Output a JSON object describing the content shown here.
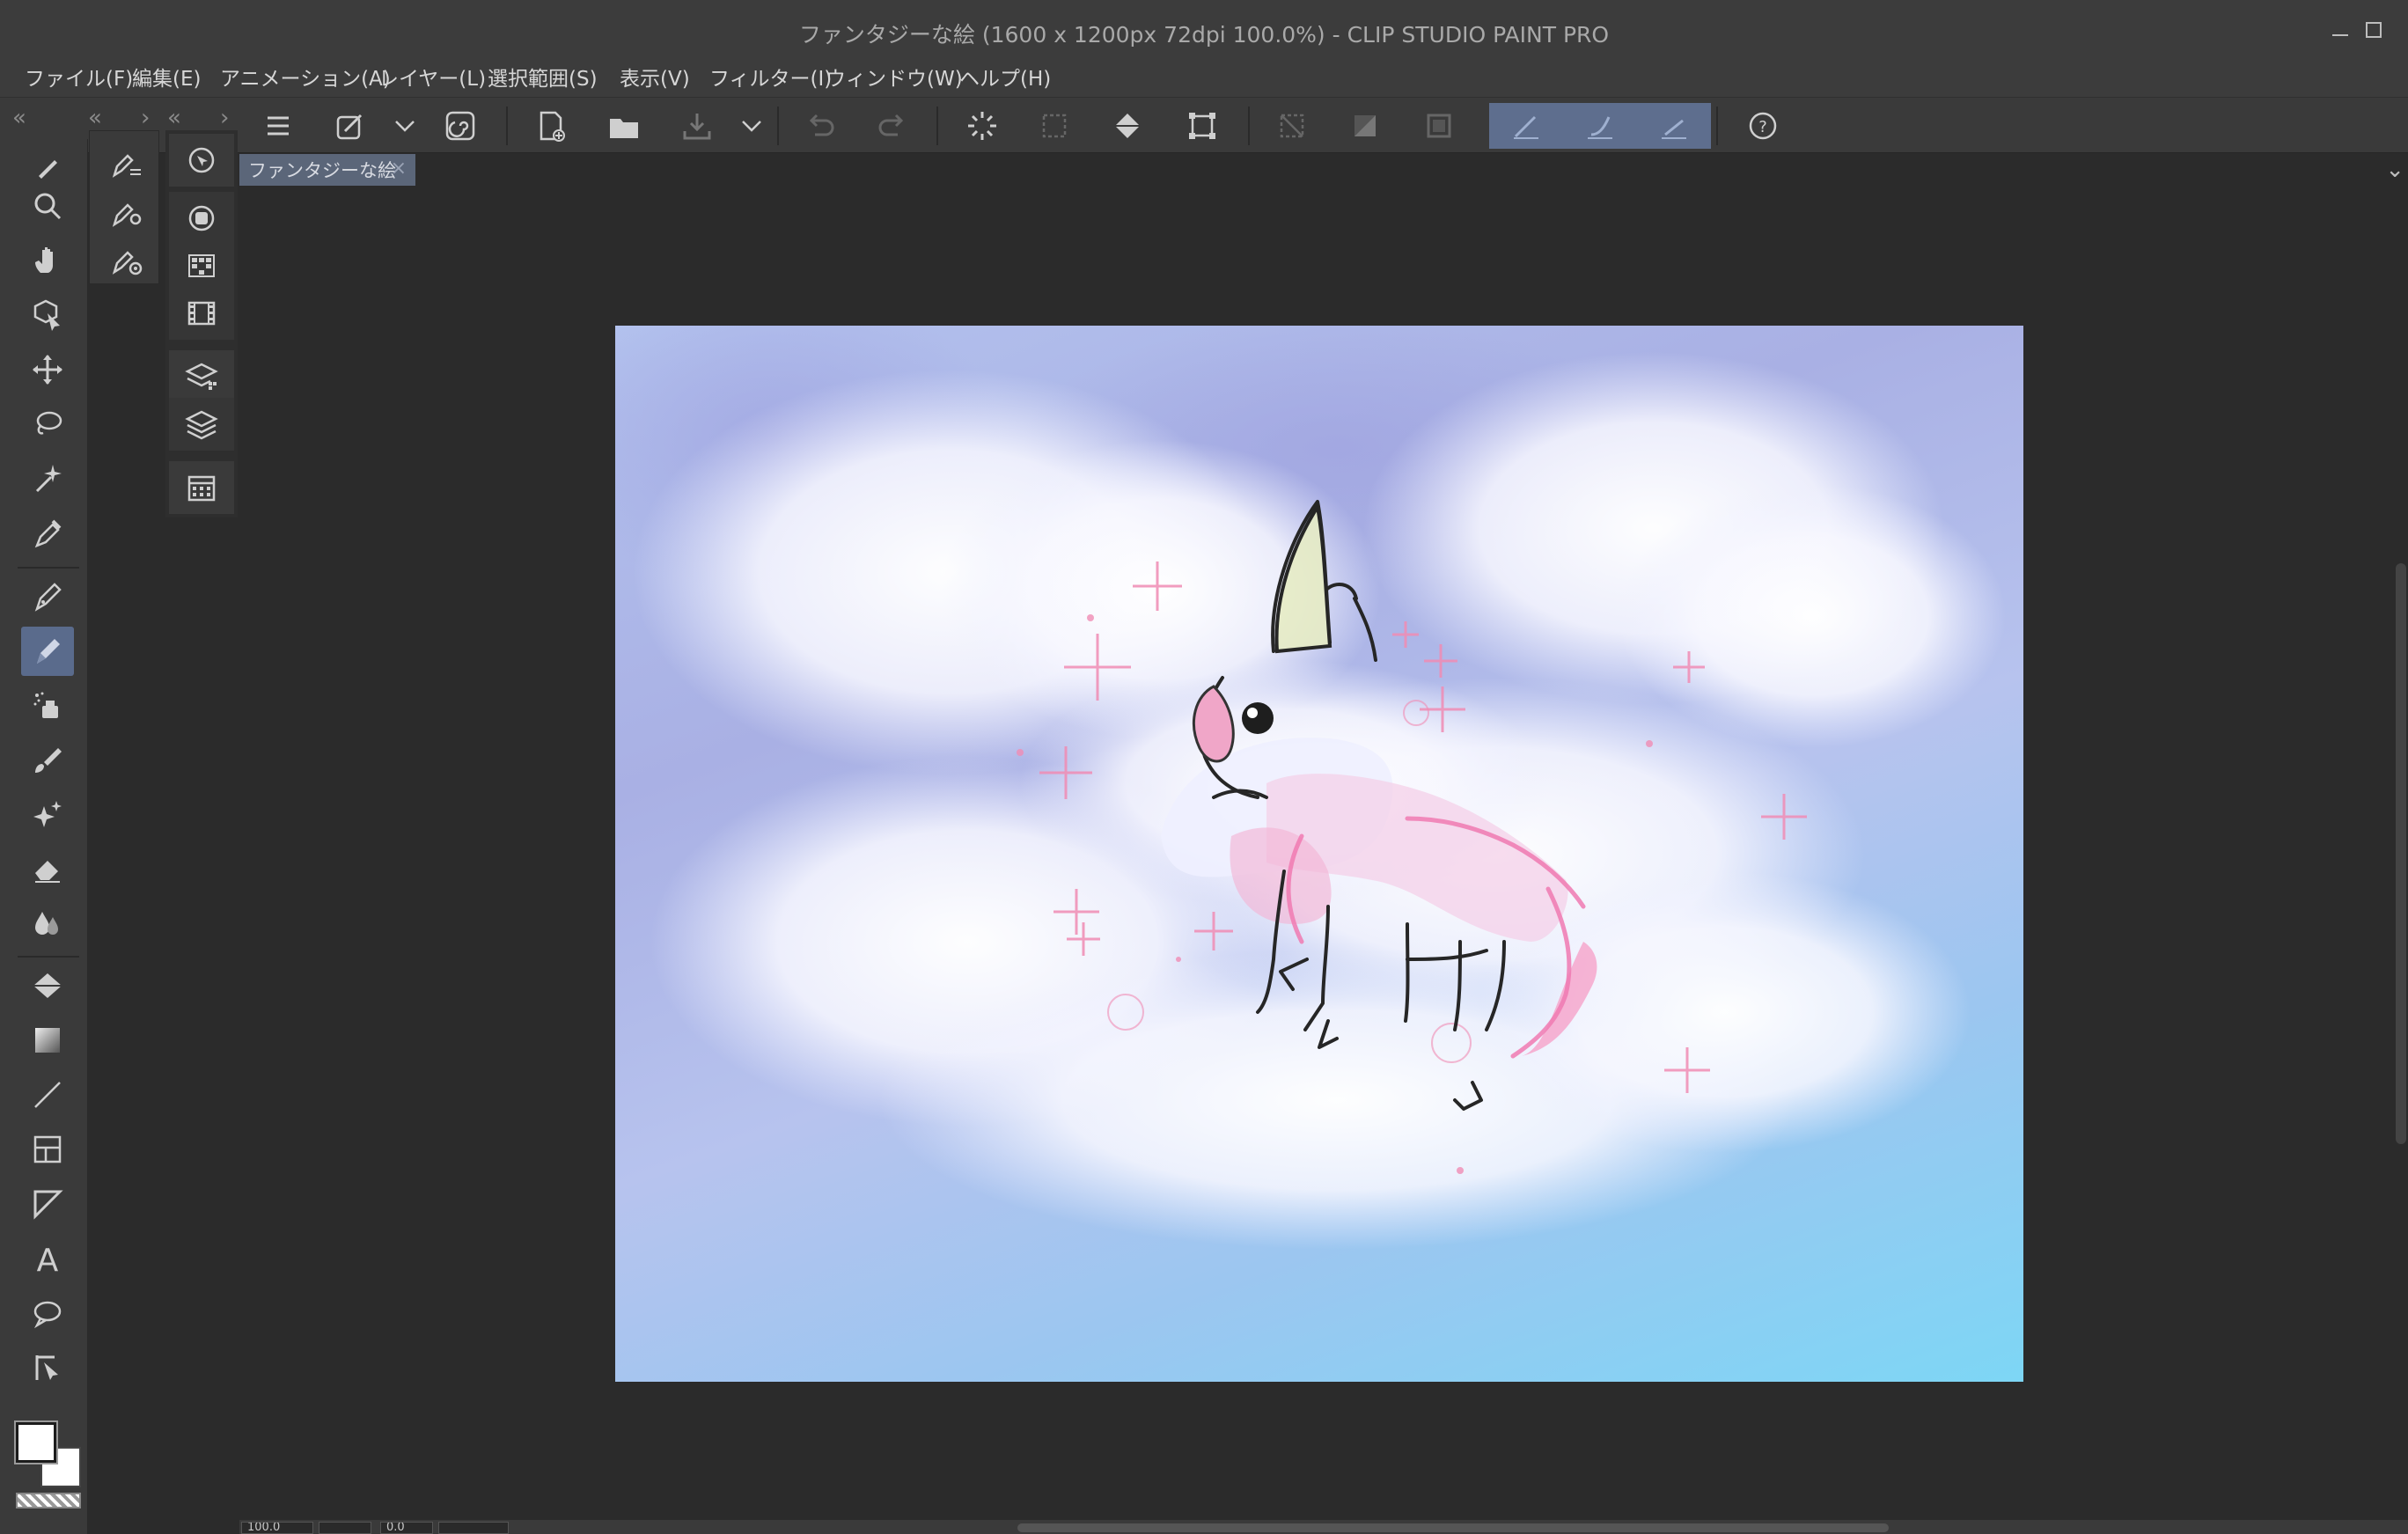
{
  "window": {
    "title": "ファンタジーな絵 (1600 x 1200px 72dpi 100.0%)  - CLIP STUDIO PAINT PRO"
  },
  "menu": [
    "ファイル(F)",
    "編集(E)",
    "アニメーション(A)",
    "レイヤー(L)",
    "選択範囲(S)",
    "表示(V)",
    "フィルター(I)",
    "ウィンドウ(W)",
    "ヘルプ(H)"
  ],
  "document": {
    "tab_label": "ファンタジーな絵",
    "close_glyph": "×",
    "size": "1600 x 1200px",
    "dpi": "72dpi",
    "zoom": "100.0%"
  },
  "status": {
    "zoom": "100.0",
    "angle": "0.0"
  },
  "icons": {
    "toolbar": [
      "menu-icon",
      "clip-studio-icon",
      "dropdown-icon",
      "spiral-icon",
      "new-icon",
      "open-icon",
      "save-icon",
      "dropdown-icon",
      "undo-icon",
      "redo-icon",
      "loading-icon",
      "select-icon",
      "fill-icon",
      "transform-icon",
      "deselect-icon",
      "gradient-icon",
      "crop-icon",
      "pen-stroke-icon",
      "brush-stroke-icon",
      "line-stroke-icon",
      "help-icon"
    ],
    "tools": [
      "zoom-icon",
      "hand-icon",
      "object-icon",
      "move-icon",
      "lasso-icon",
      "magic-wand-icon",
      "eyedropper-icon",
      "pen-icon",
      "pencil-icon",
      "airbrush-icon",
      "brush-icon",
      "decoration-icon",
      "eraser-icon",
      "blend-icon",
      "fill-icon",
      "gradient-icon",
      "line-icon",
      "frame-icon",
      "ruler-icon",
      "text-icon",
      "balloon-icon",
      "correction-icon"
    ]
  },
  "colors": {
    "main_color": "#ffffff",
    "sub_color": "#ffffff",
    "active_tool_bg": "#5a6b8c",
    "tab_bg": "#5b6679"
  }
}
